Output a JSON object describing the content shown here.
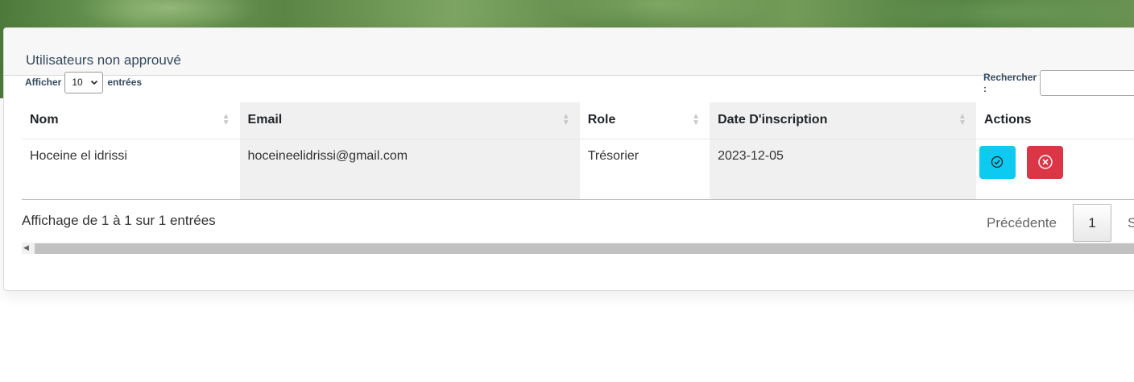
{
  "card": {
    "title": "Utilisateurs non approuvé"
  },
  "length": {
    "prefix": "Afficher",
    "value": "10",
    "suffix": "entrées"
  },
  "search": {
    "label": "Rechercher :",
    "value": ""
  },
  "table": {
    "columns": [
      "Nom",
      "Email",
      "Role",
      "Date D'inscription",
      "Actions"
    ],
    "rows": [
      {
        "nom": "Hoceine el idrissi",
        "email": "hoceineelidrissi@gmail.com",
        "role": "Trésorier",
        "date": "2023-12-05"
      }
    ]
  },
  "actions": {
    "approve_icon": "check-circle-icon",
    "reject_icon": "x-circle-icon"
  },
  "colors": {
    "approve": "#0dcaf0",
    "reject": "#dc3545",
    "title": "#34495e"
  },
  "footer": {
    "info": "Affichage de 1 à 1 sur 1 entrées",
    "prev": "Précédente",
    "page": "1",
    "next": "S"
  }
}
